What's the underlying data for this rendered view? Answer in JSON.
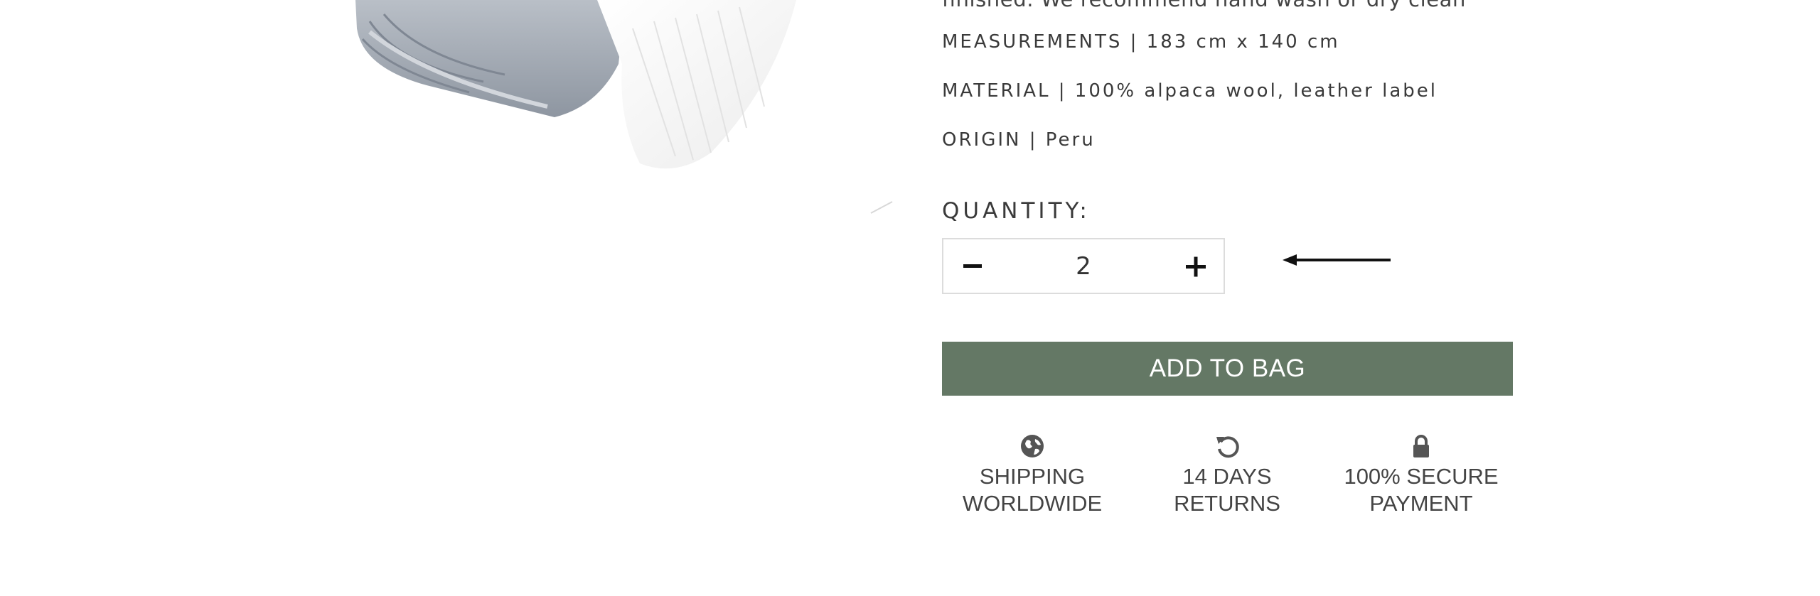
{
  "product": {
    "care_text_partial": "finished. We recommend hand wash or dry clean",
    "specs": [
      {
        "label": "MEASUREMENTS",
        "value": "183 cm x 140 cm"
      },
      {
        "label": "MATERIAL",
        "value": "100% alpaca wool, leather label"
      },
      {
        "label": "ORIGIN",
        "value": "Peru"
      }
    ],
    "specs_text": [
      "MEASUREMENTS | 183 cm x 140 cm",
      "MATERIAL | 100% alpaca wool, leather label",
      "ORIGIN | Peru"
    ]
  },
  "quantity": {
    "label": "QUANTITY:",
    "value": "2",
    "minus_icon": "minus-icon",
    "plus_icon": "plus-icon"
  },
  "annotation": {
    "icon": "left-arrow-icon"
  },
  "cart": {
    "add_label": "ADD TO BAG",
    "button_color": "#647865"
  },
  "features": [
    {
      "icon": "globe-icon",
      "line1": "SHIPPING",
      "line2": "WORLDWIDE"
    },
    {
      "icon": "rotate-left-icon",
      "line1": "14 DAYS",
      "line2": "RETURNS"
    },
    {
      "icon": "lock-icon",
      "line1": "100% SECURE",
      "line2": "PAYMENT"
    }
  ]
}
